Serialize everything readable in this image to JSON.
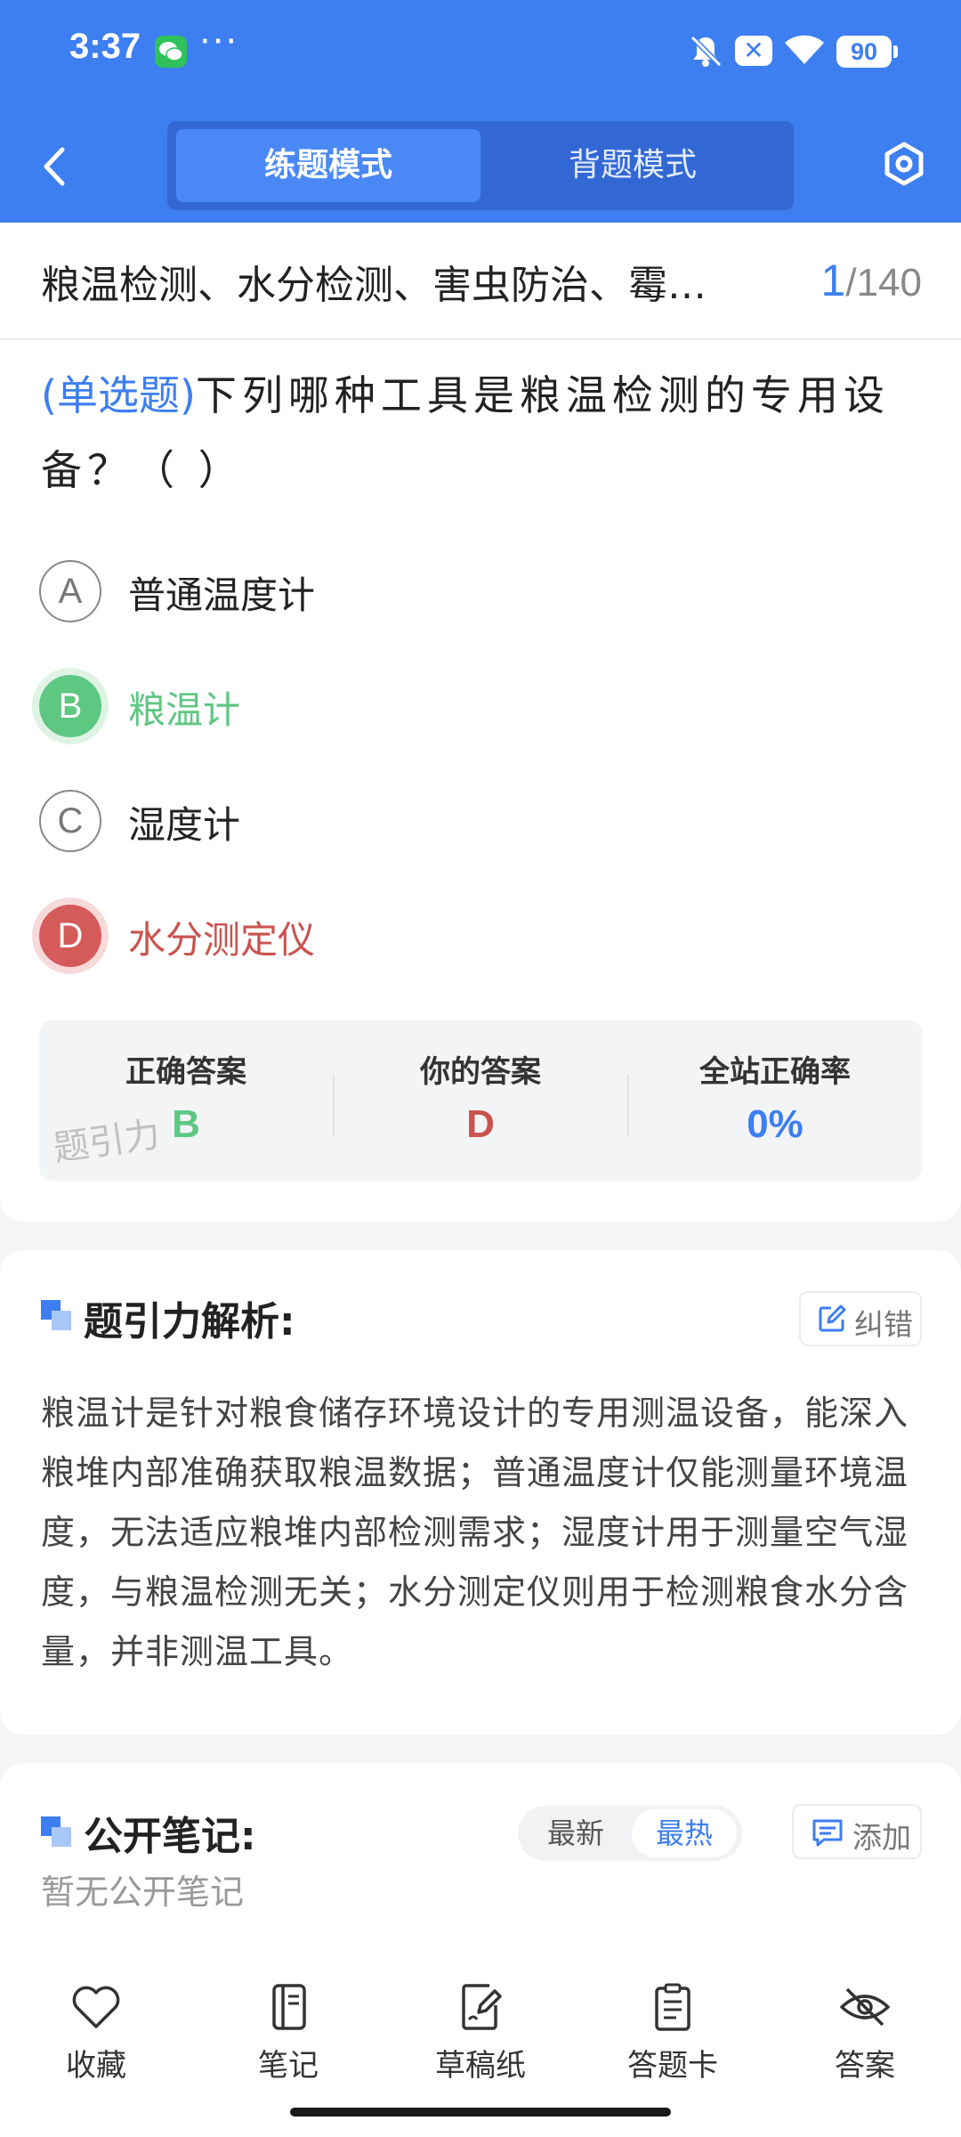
{
  "status_bar": {
    "time": "3:37",
    "dots": "···",
    "battery": "90",
    "icons": [
      "wechat-icon",
      "bell-off-icon",
      "xbox-icon",
      "wifi-icon",
      "battery-icon"
    ]
  },
  "header": {
    "modes": [
      {
        "label": "练题模式",
        "active": true
      },
      {
        "label": "背题模式",
        "active": false
      }
    ],
    "icons": [
      "back-icon",
      "settings-icon"
    ]
  },
  "question": {
    "category": "粮温检测、水分检测、害虫防治、霉…",
    "current": "1",
    "separator": "/",
    "total": "140",
    "type": "(单选题)",
    "stem": "下列哪种工具是粮温检测的专用设备？（ ）",
    "options": [
      {
        "letter": "A",
        "text": "普通温度计",
        "state": "normal"
      },
      {
        "letter": "B",
        "text": "粮温计",
        "state": "correct"
      },
      {
        "letter": "C",
        "text": "湿度计",
        "state": "normal"
      },
      {
        "letter": "D",
        "text": "水分测定仪",
        "state": "wrong"
      }
    ]
  },
  "answer_summary": {
    "correct_label": "正确答案",
    "correct_value": "B",
    "yours_label": "你的答案",
    "yours_value": "D",
    "rate_label": "全站正确率",
    "rate_value": "0%",
    "watermark": "题引力",
    "colors": {
      "correct": "#5ec782",
      "wrong": "#c9534f",
      "rate": "#3d7ef0"
    }
  },
  "analysis": {
    "title": "题引力解析:",
    "report_label": "纠错",
    "text": "粮温计是针对粮食储存环境设计的专用测温设备，能深入粮堆内部准确获取粮温数据；普通温度计仅能测量环境温度，无法适应粮堆内部检测需求；湿度计用于测量空气湿度，与粮温检测无关；水分测定仪则用于检测粮食水分含量，并非测温工具。"
  },
  "notes": {
    "title": "公开笔记:",
    "sort_options": [
      {
        "label": "最新",
        "active": false
      },
      {
        "label": "最热",
        "active": true
      }
    ],
    "add_label": "添加",
    "empty_text": "暂无公开笔记"
  },
  "bottom_bar": {
    "items": [
      {
        "label": "收藏",
        "icon": "heart-icon"
      },
      {
        "label": "笔记",
        "icon": "notebook-icon"
      },
      {
        "label": "草稿纸",
        "icon": "draft-icon"
      },
      {
        "label": "答题卡",
        "icon": "answer-card-icon"
      },
      {
        "label": "答案",
        "icon": "eye-off-icon"
      }
    ]
  },
  "theme": {
    "accent": "#3d7ef0",
    "background": "#f4f5f7"
  }
}
